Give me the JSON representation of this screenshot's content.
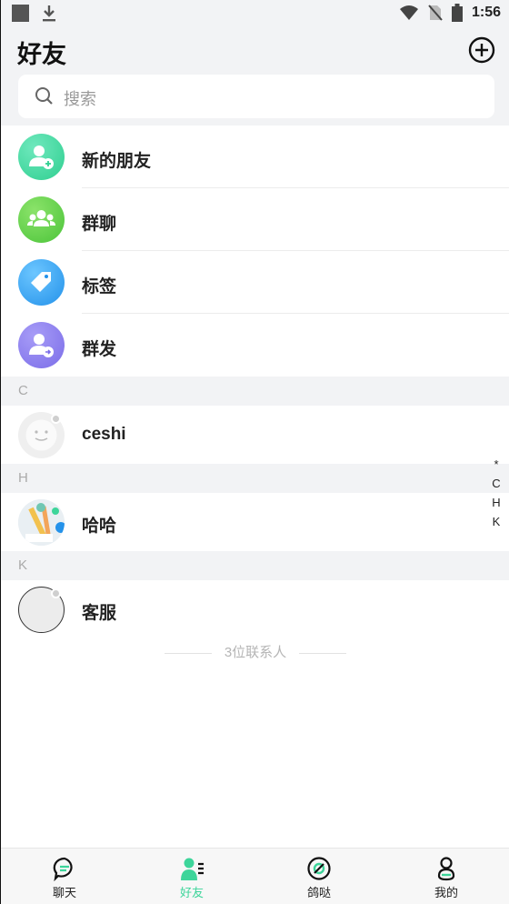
{
  "status_bar": {
    "time": "1:56"
  },
  "header": {
    "title": "好友"
  },
  "search": {
    "placeholder": "搜索"
  },
  "menu": [
    {
      "label": "新的朋友",
      "icon": "add-friend-icon",
      "color": "#3ad39c"
    },
    {
      "label": "群聊",
      "icon": "group-chat-icon",
      "color": "#5bcd4a"
    },
    {
      "label": "标签",
      "icon": "tag-icon",
      "color": "#2f9ff0"
    },
    {
      "label": "群发",
      "icon": "broadcast-icon",
      "color": "#8b7ef0"
    }
  ],
  "sections": [
    {
      "letter": "C",
      "contacts": [
        {
          "name": "ceshi"
        }
      ]
    },
    {
      "letter": "H",
      "contacts": [
        {
          "name": "哈哈"
        }
      ]
    },
    {
      "letter": "K",
      "contacts": [
        {
          "name": "客服"
        }
      ]
    }
  ],
  "contact_count": "3位联系人",
  "index_letters": [
    "*",
    "C",
    "H",
    "K"
  ],
  "tabs": [
    {
      "label": "聊天",
      "icon": "chat-icon",
      "active": false
    },
    {
      "label": "好友",
      "icon": "friends-icon",
      "active": true
    },
    {
      "label": "鸽哒",
      "icon": "discover-icon",
      "active": false
    },
    {
      "label": "我的",
      "icon": "profile-icon",
      "active": false
    }
  ],
  "colors": {
    "accent": "#3dd59a",
    "background": "#f2f3f5"
  }
}
